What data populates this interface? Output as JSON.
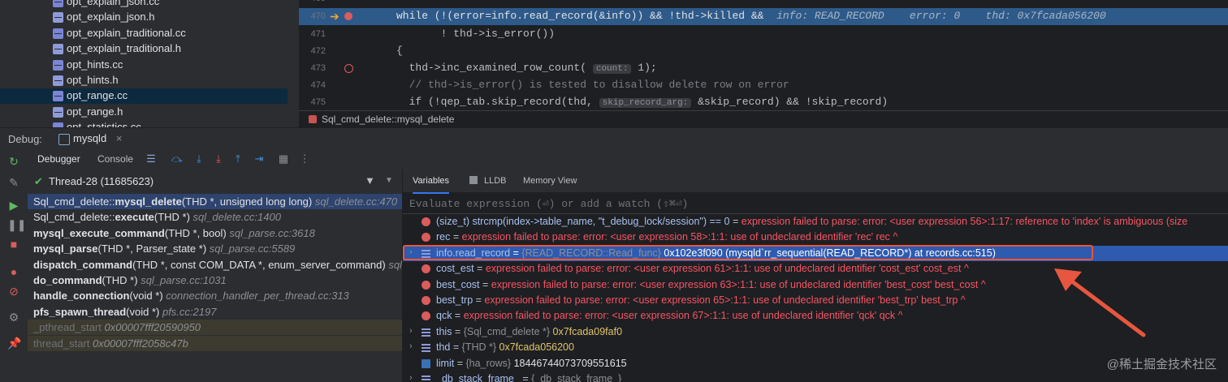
{
  "project_tree": {
    "files": [
      {
        "name": "opt_explain_json.cc",
        "type": "cc",
        "selected": false
      },
      {
        "name": "opt_explain_json.h",
        "type": "h",
        "selected": false
      },
      {
        "name": "opt_explain_traditional.cc",
        "type": "cc",
        "selected": false
      },
      {
        "name": "opt_explain_traditional.h",
        "type": "h",
        "selected": false
      },
      {
        "name": "opt_hints.cc",
        "type": "cc",
        "selected": false
      },
      {
        "name": "opt_hints.h",
        "type": "h",
        "selected": false
      },
      {
        "name": "opt_range.cc",
        "type": "cc",
        "selected": true
      },
      {
        "name": "opt_range.h",
        "type": "h",
        "selected": false
      },
      {
        "name": "opt_statistics.cc",
        "type": "cc",
        "selected": false
      }
    ]
  },
  "editor": {
    "lines": [
      {
        "num": "469",
        "text": ""
      },
      {
        "num": "470",
        "text": "while (!(error=info.read_record(&info)) && !thd->killed &&",
        "inline": "info: READ_RECORD    error: 0    thd: 0x7fcada056200",
        "current": true
      },
      {
        "num": "471",
        "text": "       ! thd->is_error())"
      },
      {
        "num": "472",
        "text": "{"
      },
      {
        "num": "473",
        "text": "  thd->inc_examined_row_count(",
        "hint": "count:",
        "tail": "1);"
      },
      {
        "num": "474",
        "text": "  // thd->is_error() is tested to disallow delete row on error"
      },
      {
        "num": "475",
        "text": "  if (!qep_tab.skip_record(thd,",
        "hint": "skip_record_arg:",
        "tail": "&skip_record) && !skip_record)"
      }
    ],
    "breadcrumb": "Sql_cmd_delete::mysql_delete"
  },
  "debug": {
    "label": "Debug:",
    "session_tab": "mysqld",
    "close_glyph": "×",
    "tabs": {
      "debugger": "Debugger",
      "console": "Console"
    },
    "thread": "Thread-28 (11685623)",
    "frames": [
      {
        "class": "Sql_cmd_delete::",
        "func": "mysql_delete",
        "args": "(THD *, unsigned long long)",
        "loc": "sql_delete.cc:470",
        "state": "selected"
      },
      {
        "class": "Sql_cmd_delete::",
        "func": "execute",
        "args": "(THD *)",
        "loc": "sql_delete.cc:1400",
        "state": "normal"
      },
      {
        "class": "",
        "func": "mysql_execute_command",
        "args": "(THD *, bool)",
        "loc": "sql_parse.cc:3618",
        "state": "normal"
      },
      {
        "class": "",
        "func": "mysql_parse",
        "args": "(THD *, Parser_state *)",
        "loc": "sql_parse.cc:5589",
        "state": "normal"
      },
      {
        "class": "",
        "func": "dispatch_command",
        "args": "(THD *, const COM_DATA *, enum_server_command)",
        "loc": "sql_parse.cc",
        "state": "normal"
      },
      {
        "class": "",
        "func": "do_command",
        "args": "(THD *)",
        "loc": "sql_parse.cc:1031",
        "state": "normal"
      },
      {
        "class": "",
        "func": "handle_connection",
        "args": "(void *)",
        "loc": "connection_handler_per_thread.cc:313",
        "state": "normal"
      },
      {
        "class": "",
        "func": "pfs_spawn_thread",
        "args": "(void *)",
        "loc": "pfs.cc:2197",
        "state": "normal"
      },
      {
        "class": "",
        "func": "_pthread_start",
        "args": "",
        "loc": "0x00007fff20590950",
        "state": "dim"
      },
      {
        "class": "",
        "func": "thread_start",
        "args": "",
        "loc": "0x00007fff2058c47b",
        "state": "dim"
      }
    ],
    "var_tabs": {
      "variables": "Variables",
      "lldb": "LLDB",
      "memory": "Memory View"
    },
    "eval_placeholder": "Evaluate expression (⏎) or add a watch (⇧⌘⏎)",
    "variables": [
      {
        "kind": "err",
        "name": "(size_t) strcmp(index->table_name, \"t_debug_lock/session\") == 0",
        "value": "expression failed to parse: error: <user expression 56>:1:17: reference to 'index' is ambiguous (size"
      },
      {
        "kind": "err",
        "name": "rec",
        "value": "expression failed to parse: error: <user expression 58>:1:1: use of undeclared identifier 'rec' rec ^"
      },
      {
        "kind": "obj",
        "name": "info.read_record",
        "type": "{READ_RECORD::Read_func}",
        "value": "0x102e3f090 (mysqld`rr_sequential(READ_RECORD*) at records.cc:515)",
        "selected": true,
        "expand": "›"
      },
      {
        "kind": "err",
        "name": "cost_est",
        "value": "expression failed to parse: error: <user expression 61>:1:1: use of undeclared identifier 'cost_est' cost_est ^"
      },
      {
        "kind": "err",
        "name": "best_cost",
        "value": "expression failed to parse: error: <user expression 63>:1:1: use of undeclared identifier 'best_cost' best_cost ^"
      },
      {
        "kind": "err",
        "name": "best_trp",
        "value": "expression failed to parse: error: <user expression 65>:1:1: use of undeclared identifier 'best_trp' best_trp ^"
      },
      {
        "kind": "err",
        "name": "qck",
        "value": "expression failed to parse: error: <user expression 67>:1:1: use of undeclared identifier 'qck' qck ^"
      },
      {
        "kind": "obj",
        "name": "this",
        "type": "{Sql_cmd_delete *}",
        "value": "0x7fcada09faf0",
        "expand": "›"
      },
      {
        "kind": "obj",
        "name": "thd",
        "type": "{THD *}",
        "value": "0x7fcada056200",
        "expand": "›"
      },
      {
        "kind": "prim",
        "name": "limit",
        "type": "{ha_rows}",
        "value": "18446744073709551615"
      },
      {
        "kind": "obj",
        "name": "_db_stack_frame_",
        "type": "{_db_stack_frame_}",
        "value": "",
        "expand": "›"
      }
    ]
  },
  "watermark": "@稀土掘金技术社区",
  "colors": {
    "accent": "#3574f0",
    "selection": "#2e5ab0",
    "error": "#f75464",
    "annotation": "#e8563f"
  }
}
